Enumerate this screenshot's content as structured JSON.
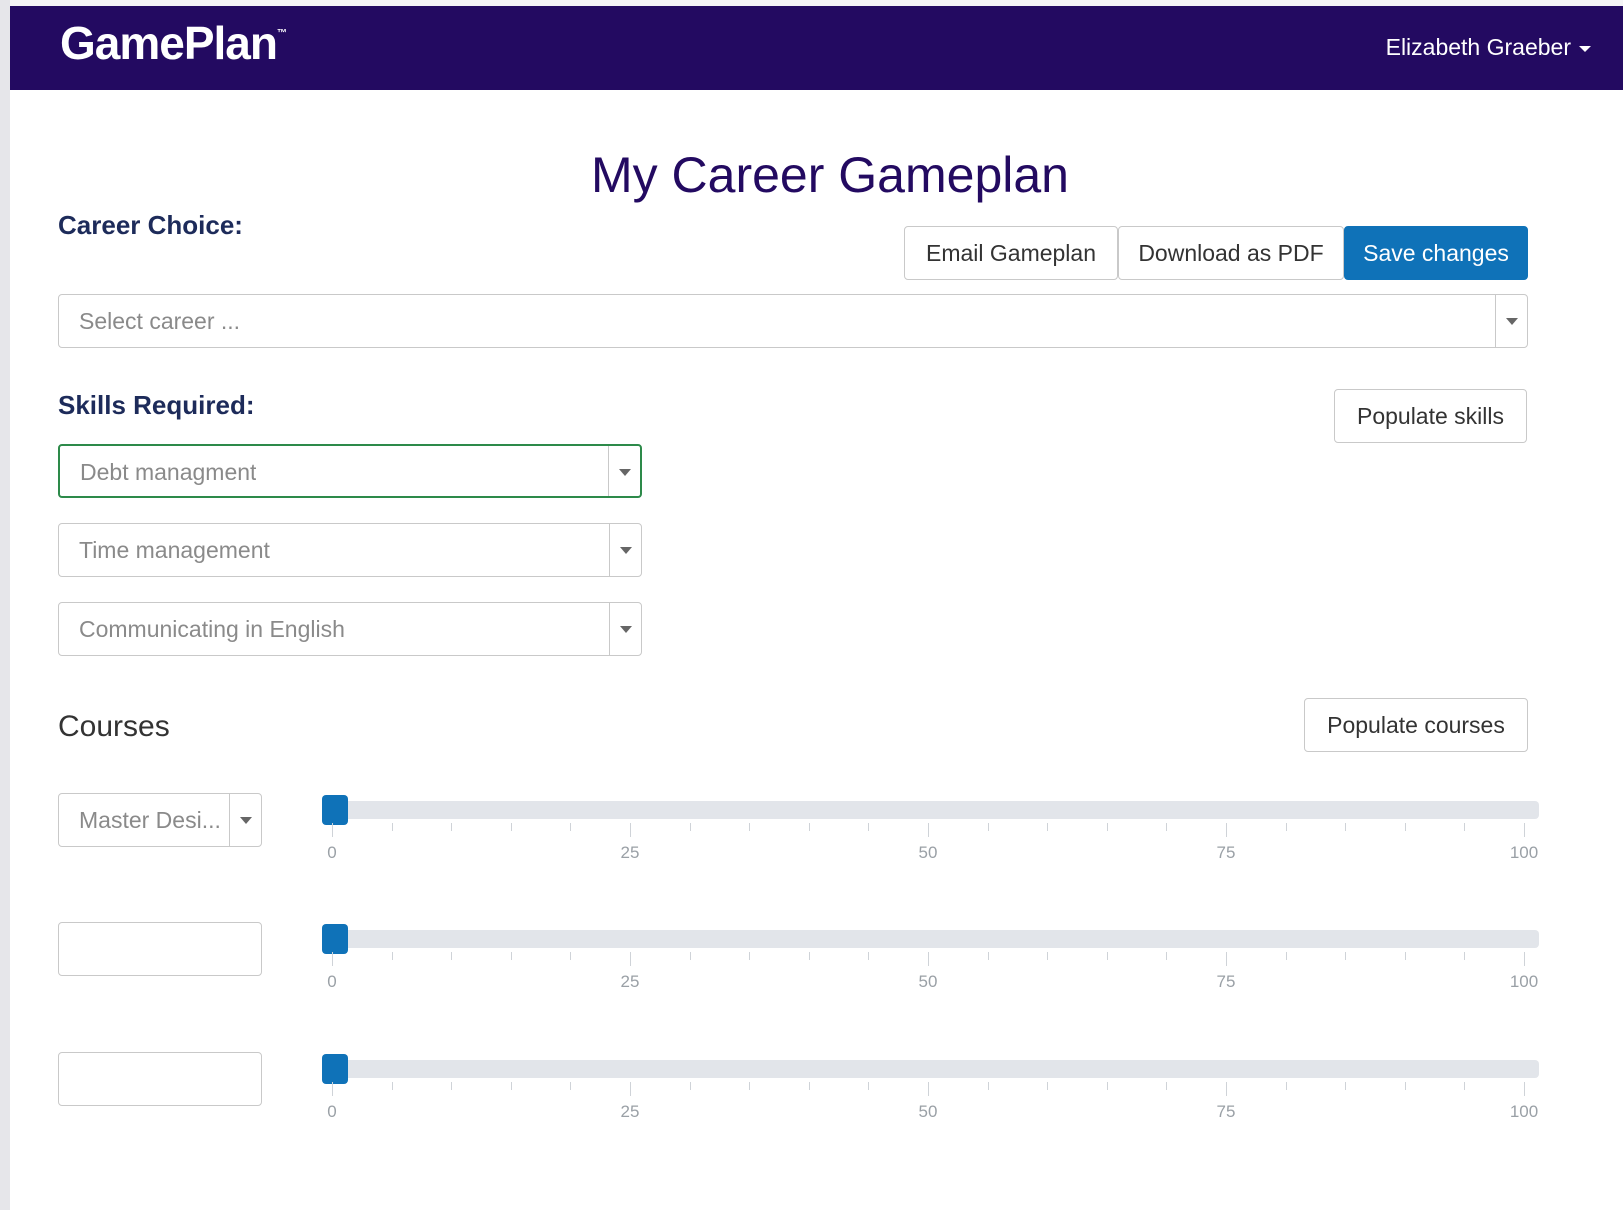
{
  "header": {
    "logo": "GamePlan",
    "logo_tm": "™",
    "user_name": "Elizabeth Graeber"
  },
  "page": {
    "title": "My Career Gameplan"
  },
  "career": {
    "label": "Career Choice:",
    "placeholder": "Select career ..."
  },
  "actions": {
    "email": "Email Gameplan",
    "pdf": "Download as PDF",
    "save": "Save changes"
  },
  "skills": {
    "label": "Skills Required:",
    "populate": "Populate skills",
    "items": [
      "Debt managment",
      "Time management",
      "Communicating in English"
    ]
  },
  "courses": {
    "label": "Courses",
    "populate": "Populate courses",
    "rows": [
      {
        "course": "Master Desi...",
        "progress": 0
      },
      {
        "course": "",
        "progress": 0
      },
      {
        "course": "",
        "progress": 0
      }
    ],
    "scale": {
      "min": 0,
      "max": 100,
      "labels": [
        "0",
        "25",
        "50",
        "75",
        "100"
      ]
    }
  },
  "colors": {
    "navbar": "#230a61",
    "primary": "#0f72b8",
    "active_border": "#2d8a4a"
  }
}
